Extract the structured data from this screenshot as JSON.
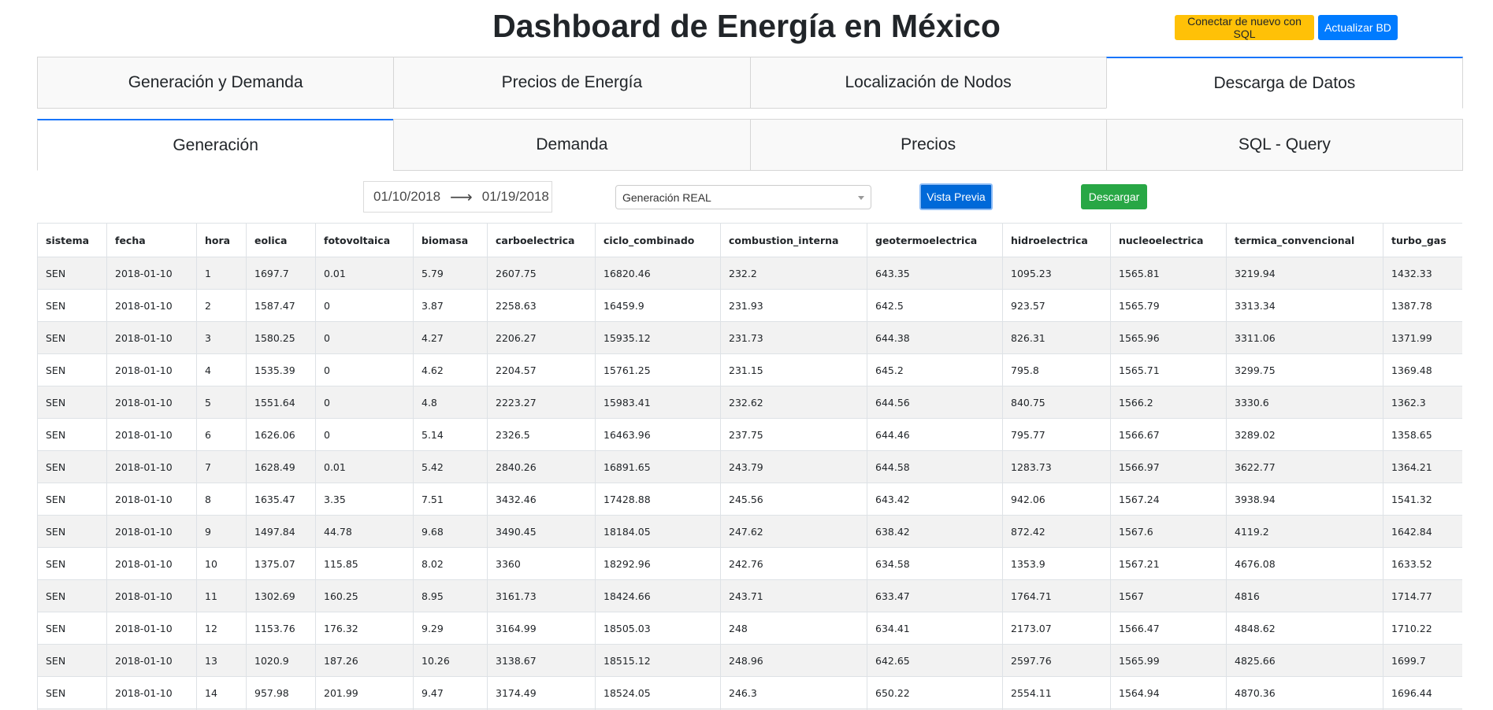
{
  "header": {
    "title": "Dashboard de Energía en México",
    "reconnect_label": "Conectar de nuevo con SQL",
    "update_label": "Actualizar BD"
  },
  "main_tabs": [
    {
      "label": "Generación y Demanda",
      "active": false
    },
    {
      "label": "Precios de Energía",
      "active": false
    },
    {
      "label": "Localización de Nodos",
      "active": false
    },
    {
      "label": "Descarga de Datos",
      "active": true
    }
  ],
  "sub_tabs": [
    {
      "label": "Generación",
      "active": true
    },
    {
      "label": "Demanda",
      "active": false
    },
    {
      "label": "Precios",
      "active": false
    },
    {
      "label": "SQL - Query",
      "active": false
    }
  ],
  "controls": {
    "start_date": "01/10/2018",
    "end_date": "01/19/2018",
    "arrow_glyph": "⟶",
    "dataset_selected": "Generación REAL",
    "preview_label": "Vista Previa",
    "download_label": "Descargar"
  },
  "colors": {
    "warning": "#ffc107",
    "primary": "#007bff",
    "success": "#28a745",
    "tab_active_border": "#1975FA"
  },
  "table": {
    "columns": [
      "sistema",
      "fecha",
      "hora",
      "eolica",
      "fotovoltaica",
      "biomasa",
      "carboelectrica",
      "ciclo_combinado",
      "combustion_interna",
      "geotermoelectrica",
      "hidroelectrica",
      "nucleoelectrica",
      "termica_convencional",
      "turbo_gas"
    ],
    "rows": [
      [
        "SEN",
        "2018-01-10",
        "1",
        "1697.7",
        "0.01",
        "5.79",
        "2607.75",
        "16820.46",
        "232.2",
        "643.35",
        "1095.23",
        "1565.81",
        "3219.94",
        "1432.33"
      ],
      [
        "SEN",
        "2018-01-10",
        "2",
        "1587.47",
        "0",
        "3.87",
        "2258.63",
        "16459.9",
        "231.93",
        "642.5",
        "923.57",
        "1565.79",
        "3313.34",
        "1387.78"
      ],
      [
        "SEN",
        "2018-01-10",
        "3",
        "1580.25",
        "0",
        "4.27",
        "2206.27",
        "15935.12",
        "231.73",
        "644.38",
        "826.31",
        "1565.96",
        "3311.06",
        "1371.99"
      ],
      [
        "SEN",
        "2018-01-10",
        "4",
        "1535.39",
        "0",
        "4.62",
        "2204.57",
        "15761.25",
        "231.15",
        "645.2",
        "795.8",
        "1565.71",
        "3299.75",
        "1369.48"
      ],
      [
        "SEN",
        "2018-01-10",
        "5",
        "1551.64",
        "0",
        "4.8",
        "2223.27",
        "15983.41",
        "232.62",
        "644.56",
        "840.75",
        "1566.2",
        "3330.6",
        "1362.3"
      ],
      [
        "SEN",
        "2018-01-10",
        "6",
        "1626.06",
        "0",
        "5.14",
        "2326.5",
        "16463.96",
        "237.75",
        "644.46",
        "795.77",
        "1566.67",
        "3289.02",
        "1358.65"
      ],
      [
        "SEN",
        "2018-01-10",
        "7",
        "1628.49",
        "0.01",
        "5.42",
        "2840.26",
        "16891.65",
        "243.79",
        "644.58",
        "1283.73",
        "1566.97",
        "3622.77",
        "1364.21"
      ],
      [
        "SEN",
        "2018-01-10",
        "8",
        "1635.47",
        "3.35",
        "7.51",
        "3432.46",
        "17428.88",
        "245.56",
        "643.42",
        "942.06",
        "1567.24",
        "3938.94",
        "1541.32"
      ],
      [
        "SEN",
        "2018-01-10",
        "9",
        "1497.84",
        "44.78",
        "9.68",
        "3490.45",
        "18184.05",
        "247.62",
        "638.42",
        "872.42",
        "1567.6",
        "4119.2",
        "1642.84"
      ],
      [
        "SEN",
        "2018-01-10",
        "10",
        "1375.07",
        "115.85",
        "8.02",
        "3360",
        "18292.96",
        "242.76",
        "634.58",
        "1353.9",
        "1567.21",
        "4676.08",
        "1633.52"
      ],
      [
        "SEN",
        "2018-01-10",
        "11",
        "1302.69",
        "160.25",
        "8.95",
        "3161.73",
        "18424.66",
        "243.71",
        "633.47",
        "1764.71",
        "1567",
        "4816",
        "1714.77"
      ],
      [
        "SEN",
        "2018-01-10",
        "12",
        "1153.76",
        "176.32",
        "9.29",
        "3164.99",
        "18505.03",
        "248",
        "634.41",
        "2173.07",
        "1566.47",
        "4848.62",
        "1710.22"
      ],
      [
        "SEN",
        "2018-01-10",
        "13",
        "1020.9",
        "187.26",
        "10.26",
        "3138.67",
        "18515.12",
        "248.96",
        "642.65",
        "2597.76",
        "1565.99",
        "4825.66",
        "1699.7"
      ],
      [
        "SEN",
        "2018-01-10",
        "14",
        "957.98",
        "201.99",
        "9.47",
        "3174.49",
        "18524.05",
        "246.3",
        "650.22",
        "2554.11",
        "1564.94",
        "4870.36",
        "1696.44"
      ],
      [
        "",
        "",
        "",
        "",
        "",
        "",
        "",
        "",
        "",
        "",
        "",
        "",
        "",
        ""
      ]
    ]
  }
}
